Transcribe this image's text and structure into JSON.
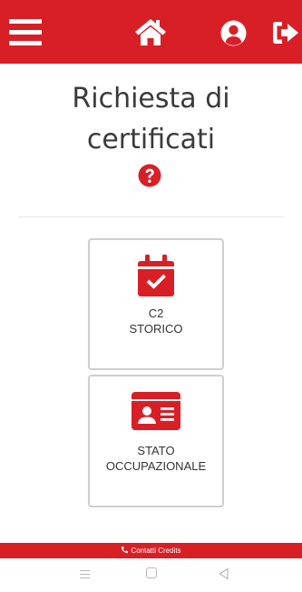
{
  "header": {
    "menu_icon": "hamburger-menu-icon",
    "home_icon": "home-icon",
    "user_icon": "user-circle-icon",
    "logout_icon": "sign-out-icon",
    "color": "#d91f26"
  },
  "page": {
    "title_line1": "Richiesta di",
    "title_line2": "certificati",
    "help_icon": "question-circle-icon"
  },
  "cards": [
    {
      "line1": "C2",
      "line2": "STORICO",
      "icon": "calendar-check-icon"
    },
    {
      "line1": "STATO",
      "line2": "OCCUPAZIONALE",
      "icon": "id-card-icon"
    }
  ],
  "footer": {
    "label": "Contatti Credits",
    "icon": "phone-icon"
  },
  "system_nav": {
    "menu": "recent-apps-icon",
    "home": "home-square-icon",
    "back": "back-triangle-icon"
  },
  "colors": {
    "accent": "#d91f26",
    "text": "#333333",
    "card_border": "#cfcfcf"
  }
}
